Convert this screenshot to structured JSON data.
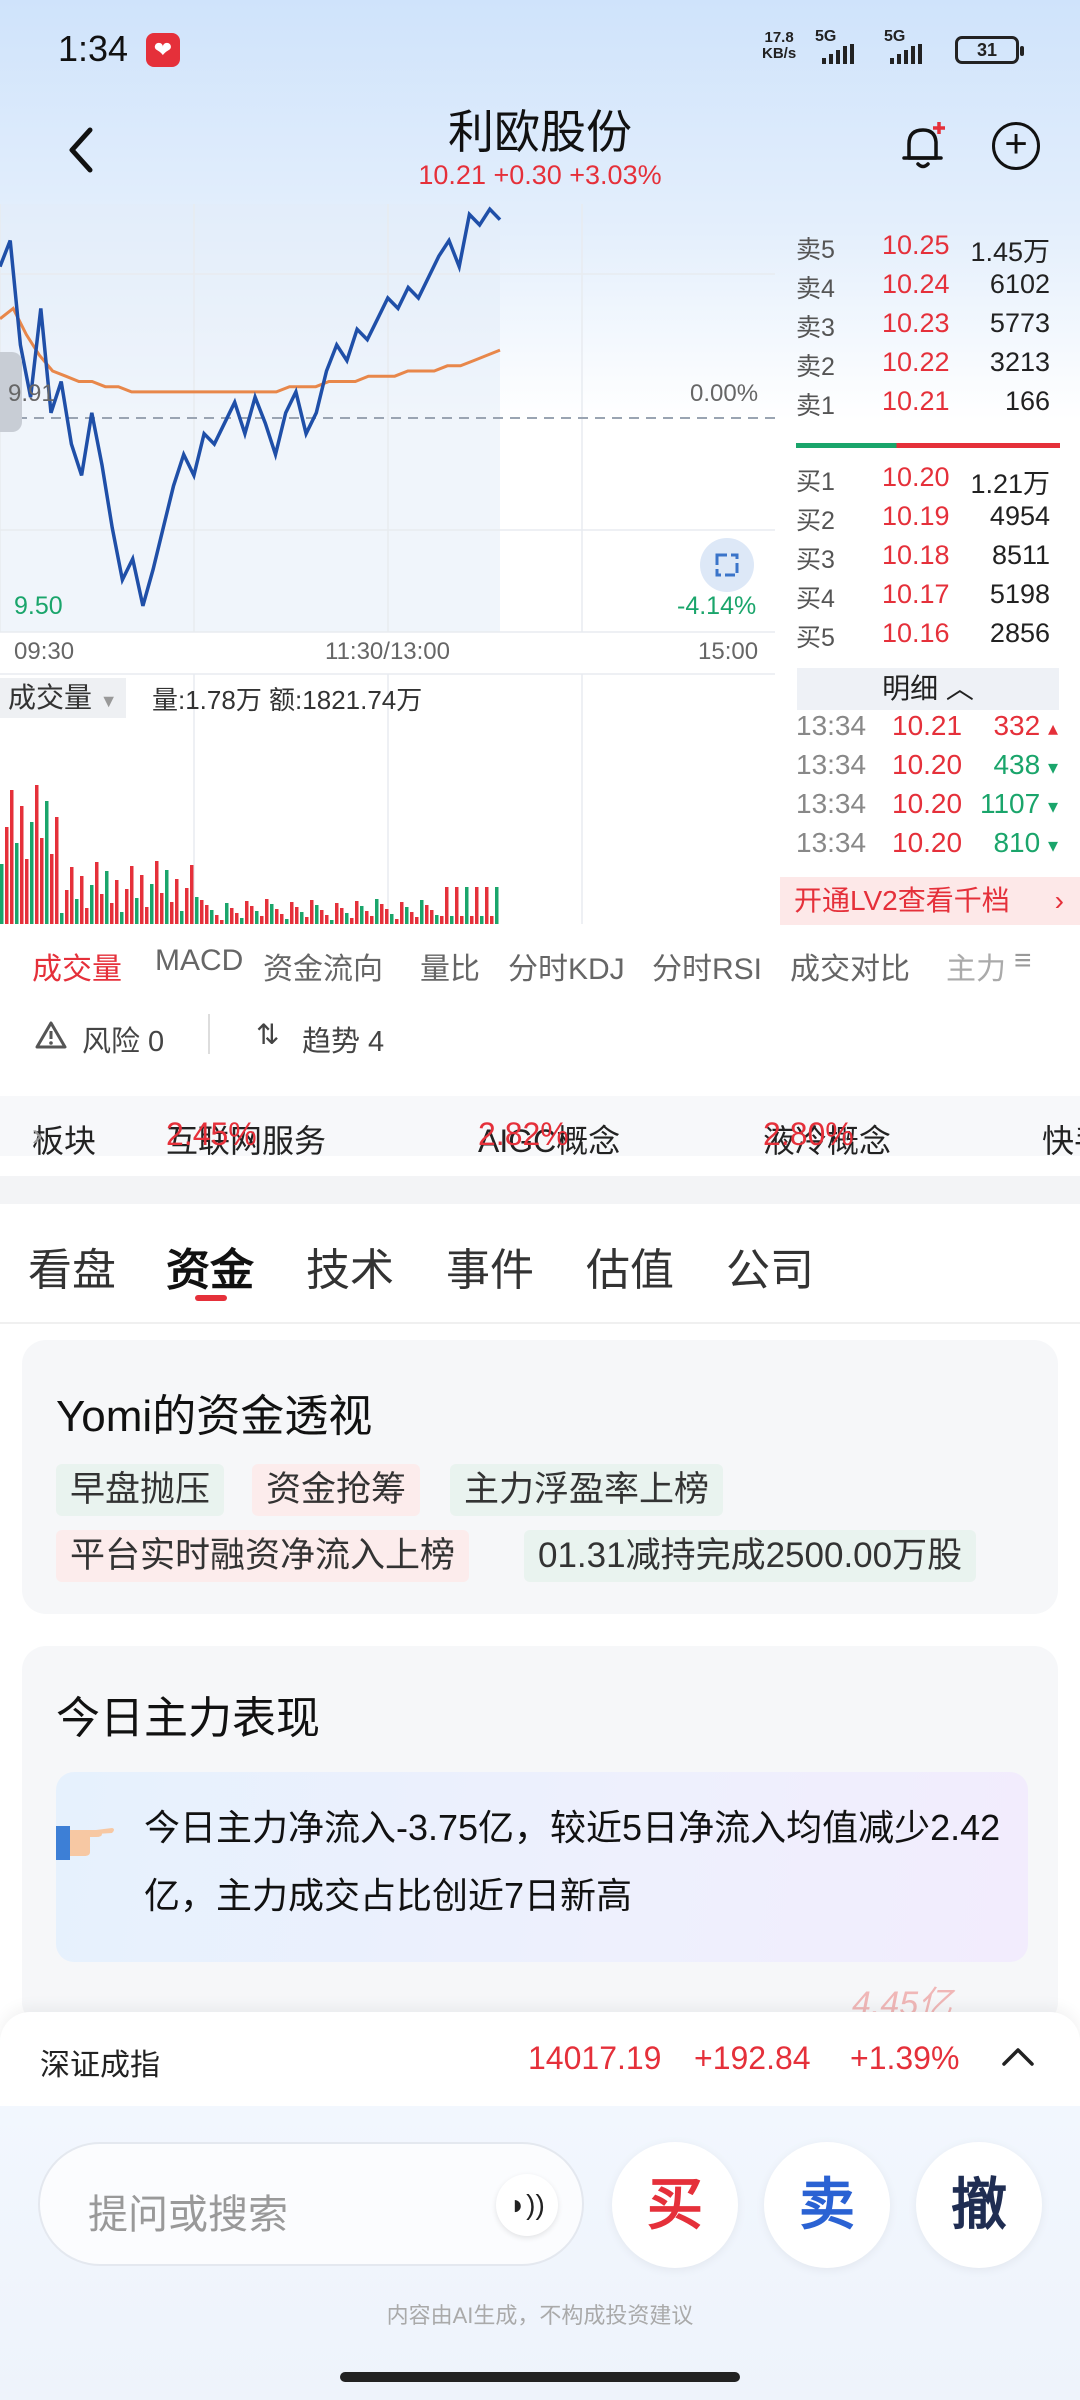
{
  "status": {
    "time": "1:34",
    "net_speed": "17.8",
    "net_unit": "KB/s",
    "sig1": "5G",
    "sig2": "5G",
    "battery": "31"
  },
  "header": {
    "title": "利欧股份",
    "price_line": "10.21 +0.30 +3.03%"
  },
  "chart": {
    "y_top_label": "",
    "y_mid_label": "9.91",
    "pct_mid": "0.00%",
    "low_label": "9.50",
    "low_pct": "-4.14%",
    "x_start": "09:30",
    "x_mid": "11:30/13:00",
    "x_end": "15:00"
  },
  "chart_data": {
    "type": "line",
    "title": "",
    "xlabel": "",
    "ylabel": "",
    "x_ticks": [
      "09:30",
      "11:30/13:00",
      "15:00"
    ],
    "ylim": [
      9.5,
      10.32
    ],
    "reference": 9.91,
    "series": [
      {
        "values": [
          10.2,
          10.25,
          10.05,
          9.95,
          10.12,
          9.92,
          9.98,
          9.86,
          9.8,
          9.92,
          9.82,
          9.7,
          9.6,
          9.64,
          9.55,
          9.62,
          9.7,
          9.78,
          9.84,
          9.8,
          9.88,
          9.86,
          9.9,
          9.94,
          9.88,
          9.95,
          9.9,
          9.84,
          9.92,
          9.96,
          9.88,
          9.92,
          10.0,
          10.05,
          10.02,
          10.08,
          10.06,
          10.1,
          10.14,
          10.12,
          10.16,
          10.14,
          10.18,
          10.22,
          10.25,
          10.2,
          10.3,
          10.28,
          10.31,
          10.29
        ]
      },
      {
        "values": [
          10.1,
          10.12,
          10.07,
          10.03,
          10.0,
          9.99,
          9.98,
          9.98,
          9.97,
          9.97,
          9.96,
          9.96,
          9.96,
          9.96,
          9.96,
          9.96,
          9.96,
          9.96,
          9.96,
          9.96,
          9.96,
          9.96,
          9.97,
          9.97,
          9.97,
          9.98,
          9.98,
          9.98,
          9.99,
          9.99,
          9.99,
          10.0,
          10.0,
          10.0,
          10.01,
          10.01,
          10.02,
          10.03,
          10.04
        ]
      }
    ]
  },
  "orderbook": {
    "asks": [
      {
        "label": "卖5",
        "price": "10.25",
        "vol": "1.45万"
      },
      {
        "label": "卖4",
        "price": "10.24",
        "vol": "6102"
      },
      {
        "label": "卖3",
        "price": "10.23",
        "vol": "5773"
      },
      {
        "label": "卖2",
        "price": "10.22",
        "vol": "3213"
      },
      {
        "label": "卖1",
        "price": "10.21",
        "vol": "166"
      }
    ],
    "bids": [
      {
        "label": "买1",
        "price": "10.20",
        "vol": "1.21万"
      },
      {
        "label": "买2",
        "price": "10.19",
        "vol": "4954"
      },
      {
        "label": "买3",
        "price": "10.18",
        "vol": "8511"
      },
      {
        "label": "买4",
        "price": "10.17",
        "vol": "5198"
      },
      {
        "label": "买5",
        "price": "10.16",
        "vol": "2856"
      }
    ],
    "detail_label": "明细",
    "ticks": [
      {
        "time": "13:34",
        "price": "10.21",
        "vol": "332",
        "dir": "up"
      },
      {
        "time": "13:34",
        "price": "10.20",
        "vol": "438",
        "dir": "down"
      },
      {
        "time": "13:34",
        "price": "10.20",
        "vol": "1107",
        "dir": "down"
      },
      {
        "time": "13:34",
        "price": "10.20",
        "vol": "810",
        "dir": "down"
      }
    ],
    "lv2_label": "开通LV2查看千档"
  },
  "volume": {
    "label": "成交量",
    "info": "量:1.78万 额:1821.74万"
  },
  "ind_tabs": [
    "成交量",
    "MACD",
    "资金流向",
    "量比",
    "分时KDJ",
    "分时RSI",
    "成交对比",
    "主力"
  ],
  "risk": {
    "risk_label": "风险 0",
    "trend_label": "趋势 4"
  },
  "sectors": {
    "label": "板块",
    "items": [
      {
        "name": "互联网服务",
        "pct": "2.45%"
      },
      {
        "name": "AIGC概念",
        "pct": "2.82%"
      },
      {
        "name": "液冷概念",
        "pct": "2.80%"
      },
      {
        "name": "快手",
        "pct": ""
      }
    ]
  },
  "main_tabs": [
    "看盘",
    "资金",
    "技术",
    "事件",
    "估值",
    "公司"
  ],
  "capital": {
    "title": "Yomi的资金透视",
    "chips": [
      "早盘抛压",
      "资金抢筹",
      "主力浮盈率上榜",
      "平台实时融资净流入上榜",
      "01.31减持完成2500.00万股"
    ]
  },
  "performance": {
    "title": "今日主力表现",
    "text": "今日主力净流入-3.75亿，较近5日净流入均值减少2.42亿，主力成交占比创近7日新高",
    "peek": "4.45亿"
  },
  "index": {
    "name": "深证成指",
    "value": "14017.19",
    "change": "+192.84",
    "pct": "+1.39%"
  },
  "bottom": {
    "search_placeholder": "提问或搜索",
    "buy": "买",
    "sell": "卖",
    "cancel": "撤",
    "disclaimer": "内容由AI生成，不构成投资建议"
  },
  "colors": {
    "up": "#e5303a",
    "down": "#1aa56b",
    "line": "#1f4fa8",
    "avg": "#e8874a"
  }
}
